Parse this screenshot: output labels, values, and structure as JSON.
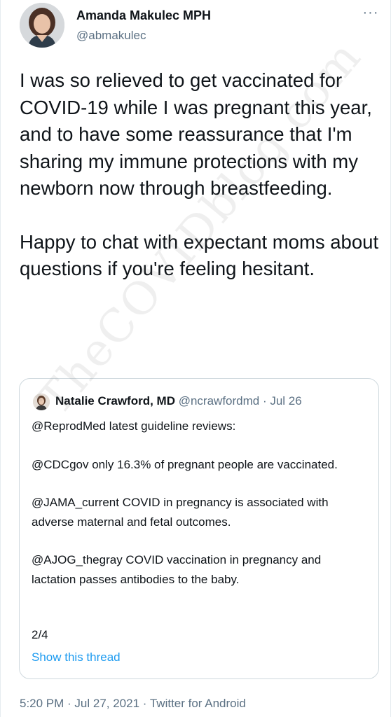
{
  "author": {
    "name": "Amanda Makulec MPH",
    "handle": "@abmakulec",
    "avatar_icon": "person-avatar"
  },
  "tweet": {
    "paragraphs": [
      "I was so relieved to get vaccinated for COVID-19 while I was pregnant this year, and to have some reassurance that I'm sharing my immune protections with my newborn now through breastfeeding.",
      "Happy to chat with expectant moms about questions if you're feeling hesitant."
    ]
  },
  "quoted_tweet": {
    "name": "Natalie Crawford, MD",
    "meta": "@ncrawfordmd · Jul 26",
    "paragraphs": [
      "@ReprodMed latest guideline reviews:",
      "@CDCgov only 16.3% of pregnant people are vaccinated.",
      "@JAMA_current COVID in pregnancy is associated with adverse maternal and fetal outcomes.",
      "@AJOG_thegray COVID vaccination in pregnancy and lactation passes antibodies to the baby."
    ],
    "page": "2/4",
    "show_thread_label": "Show this thread"
  },
  "footer": {
    "timestamp": "5:20 PM · Jul 27, 2021 · Twitter for Android"
  },
  "watermark": "TheCOVIDblog.com",
  "colors": {
    "text": "#0f1419",
    "secondary": "#5b7083",
    "link": "#1d9bf0",
    "border": "#cfd9de"
  }
}
